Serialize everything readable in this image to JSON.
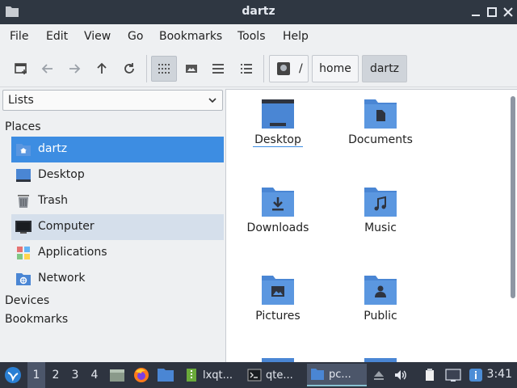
{
  "window": {
    "title": "dartz"
  },
  "menubar": {
    "items": [
      "File",
      "Edit",
      "View",
      "Go",
      "Bookmarks",
      "Tools",
      "Help"
    ]
  },
  "toolbar": {
    "path_root": "/",
    "breadcrumbs": [
      "home",
      "dartz"
    ]
  },
  "sidepane": {
    "mode": "Lists",
    "sections": {
      "places": "Places",
      "devices": "Devices",
      "bookmarks": "Bookmarks"
    },
    "places": [
      {
        "label": "dartz",
        "icon": "home-folder-icon",
        "state": "selected"
      },
      {
        "label": "Desktop",
        "icon": "desktop-icon",
        "state": ""
      },
      {
        "label": "Trash",
        "icon": "trash-icon",
        "state": ""
      },
      {
        "label": "Computer",
        "icon": "computer-icon",
        "state": "hover"
      },
      {
        "label": "Applications",
        "icon": "applications-icon",
        "state": ""
      },
      {
        "label": "Network",
        "icon": "network-icon",
        "state": ""
      }
    ]
  },
  "files": [
    {
      "name": "Desktop",
      "icon": "desktop-folder-icon"
    },
    {
      "name": "Documents",
      "icon": "documents-folder-icon"
    },
    {
      "name": "Downloads",
      "icon": "downloads-folder-icon"
    },
    {
      "name": "Music",
      "icon": "music-folder-icon"
    },
    {
      "name": "Pictures",
      "icon": "pictures-folder-icon"
    },
    {
      "name": "Public",
      "icon": "public-folder-icon"
    }
  ],
  "taskbar": {
    "desktops": [
      "1",
      "2",
      "3",
      "4"
    ],
    "tasks": [
      "lxqt...",
      "qte...",
      "pc..."
    ],
    "clock": "3:41"
  },
  "colors": {
    "accent": "#3d8de2",
    "folder": "#4a86d4",
    "titlebar": "#2f3742",
    "taskbar": "#2e3440"
  }
}
